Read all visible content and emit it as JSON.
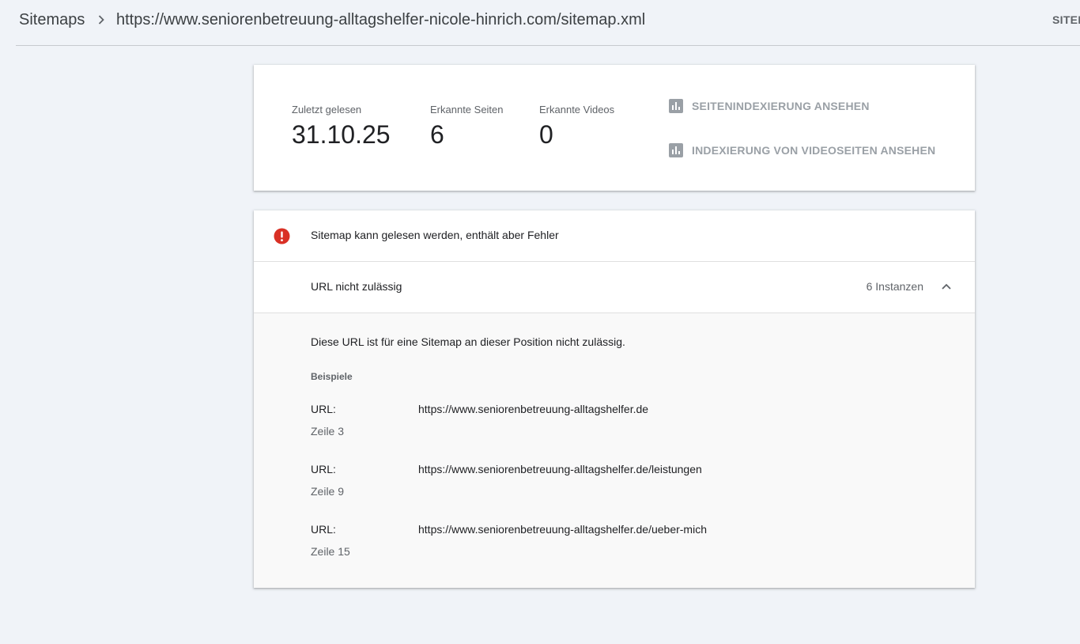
{
  "header": {
    "breadcrumb_root": "Sitemaps",
    "breadcrumb_current": "https://www.seniorenbetreuung-alltagshelfer-nicole-hinrich.com/sitemap.xml",
    "right_action": "SITEM"
  },
  "stats": [
    {
      "label": "Zuletzt gelesen",
      "value": "31.10.25"
    },
    {
      "label": "Erkannte Seiten",
      "value": "6"
    },
    {
      "label": "Erkannte Videos",
      "value": "0"
    }
  ],
  "actions": {
    "page_indexing": "SEITENINDEXIERUNG ANSEHEN",
    "video_indexing": "INDEXIERUNG VON VIDEOSEITEN ANSEHEN"
  },
  "status": {
    "text": "Sitemap kann gelesen werden, enthält aber Fehler",
    "color": "#d93025"
  },
  "issue": {
    "title": "URL nicht zulässig",
    "count": "6 Instanzen",
    "description": "Diese URL ist für eine Sitemap an dieser Position nicht zulässig.",
    "examples_label": "Beispiele",
    "examples": [
      {
        "key": "URL:",
        "url": "https://www.seniorenbetreuung-alltagshelfer.de",
        "line": "Zeile 3"
      },
      {
        "key": "URL:",
        "url": "https://www.seniorenbetreuung-alltagshelfer.de/leistungen",
        "line": "Zeile 9"
      },
      {
        "key": "URL:",
        "url": "https://www.seniorenbetreuung-alltagshelfer.de/ueber-mich",
        "line": "Zeile 15"
      }
    ]
  }
}
